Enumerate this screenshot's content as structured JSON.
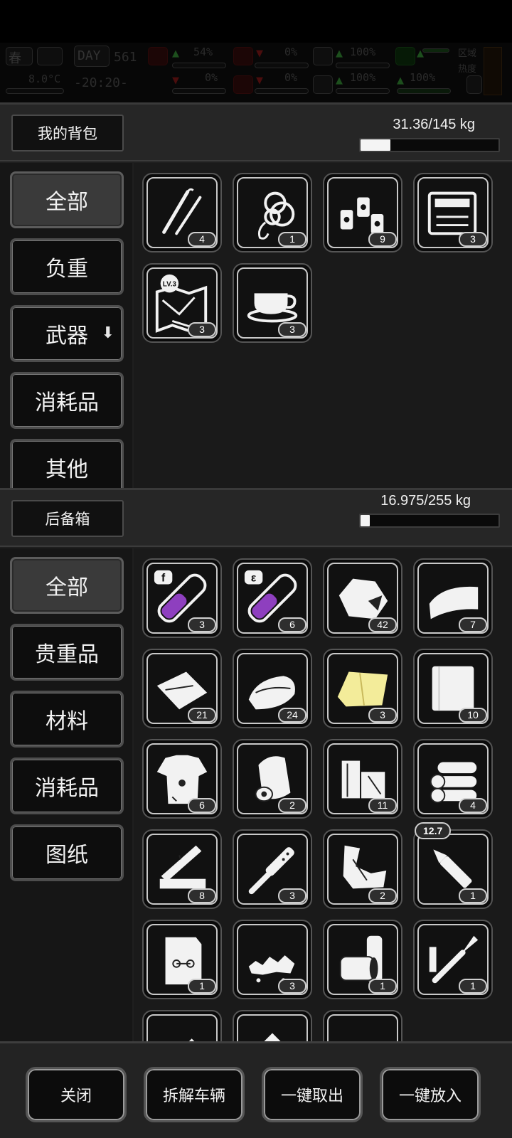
{
  "status_bar": {
    "season": "春",
    "day_label": "DAY",
    "day_value": "561",
    "temperature": "8.0°C",
    "clock": "-20:20-",
    "stats": [
      {
        "name": "health",
        "value": "54%"
      },
      {
        "name": "hunger",
        "value": "0%"
      },
      {
        "name": "stomach",
        "value": "100%"
      },
      {
        "name": "stamina",
        "value": "100%"
      },
      {
        "name": "blood",
        "value": "0%"
      },
      {
        "name": "thirst",
        "value": "0%"
      },
      {
        "name": "heart",
        "value": "100%"
      },
      {
        "name": "mood",
        "value": "100%"
      }
    ],
    "zone_heat_label_1": "区域",
    "zone_heat_label_2": "热度"
  },
  "backpack": {
    "title": "我的背包",
    "weight": "31.36/145 kg",
    "weight_fraction": 0.216,
    "tabs": [
      {
        "label": "全部",
        "active": true
      },
      {
        "label": "负重",
        "active": false
      },
      {
        "label": "武器",
        "active": false,
        "icon": "arrow-down-icon"
      },
      {
        "label": "消耗品",
        "active": false
      },
      {
        "label": "其他",
        "active": false
      }
    ],
    "items": [
      {
        "icon": "lockpick-icon",
        "count": "4"
      },
      {
        "icon": "rope-icon",
        "count": "1"
      },
      {
        "icon": "lanterns-icon",
        "count": "9"
      },
      {
        "icon": "toolkit-icon",
        "count": "3"
      },
      {
        "icon": "map-lv3-icon",
        "count": "3",
        "badge": "LV.3"
      },
      {
        "icon": "coffee-cup-icon",
        "count": "3"
      }
    ]
  },
  "trunk": {
    "title": "后备箱",
    "weight": "16.975/255 kg",
    "weight_fraction": 0.067,
    "tabs": [
      {
        "label": "全部",
        "active": true
      },
      {
        "label": "贵重品",
        "active": false
      },
      {
        "label": "材料",
        "active": false
      },
      {
        "label": "消耗品",
        "active": false
      },
      {
        "label": "图纸",
        "active": false
      }
    ],
    "items": [
      {
        "icon": "test-tube-f-icon",
        "count": "3",
        "tag": "f"
      },
      {
        "icon": "test-tube-e-icon",
        "count": "6",
        "tag": "ε"
      },
      {
        "icon": "ore-icon",
        "count": "42"
      },
      {
        "icon": "cloth-icon",
        "count": "7"
      },
      {
        "icon": "rags-icon",
        "count": "21"
      },
      {
        "icon": "folded-cloth-icon",
        "count": "24"
      },
      {
        "icon": "yellow-cloth-icon",
        "count": "3"
      },
      {
        "icon": "white-cloth-icon",
        "count": "10"
      },
      {
        "icon": "torn-shirt-icon",
        "count": "6"
      },
      {
        "icon": "paper-roll-icon",
        "count": "2"
      },
      {
        "icon": "wood-blocks-icon",
        "count": "11"
      },
      {
        "icon": "logs-icon",
        "count": "4"
      },
      {
        "icon": "planks-icon",
        "count": "8"
      },
      {
        "icon": "file-tool-icon",
        "count": "3"
      },
      {
        "icon": "scrap-metal-icon",
        "count": "2"
      },
      {
        "icon": "bullet-icon",
        "count": "1",
        "caliber": "12.7"
      },
      {
        "icon": "blueprint-bag-icon",
        "count": "1"
      },
      {
        "icon": "rubble-icon",
        "count": "3"
      },
      {
        "icon": "pipes-icon",
        "count": "1"
      },
      {
        "icon": "soldering-iron-icon",
        "count": "1"
      },
      {
        "icon": "partial-item-1-icon",
        "count": ""
      },
      {
        "icon": "partial-item-2-icon",
        "count": ""
      },
      {
        "icon": "partial-item-3-icon",
        "count": ""
      }
    ]
  },
  "footer": {
    "buttons": [
      "关闭",
      "拆解车辆",
      "一键取出",
      "一键放入"
    ]
  }
}
